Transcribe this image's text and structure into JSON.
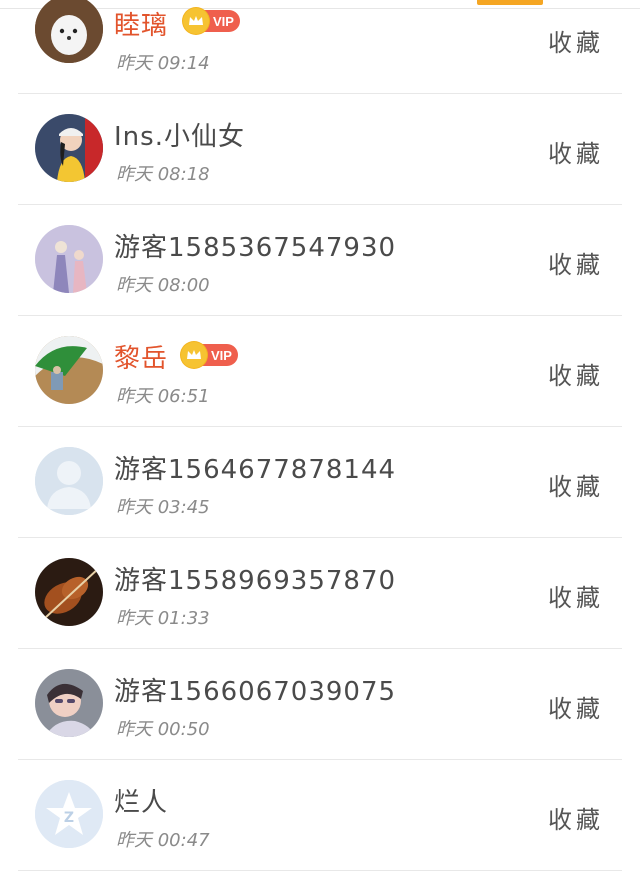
{
  "colors": {
    "accent": "#f5a623",
    "vip_name": "#e2542c",
    "vip_badge": "#ef5f4d"
  },
  "rows": [
    {
      "name": "睦璃",
      "vip": true,
      "vip_label": "VIP",
      "time": "昨天 09:14",
      "action": "收藏",
      "avatar": "white-dog-avatar"
    },
    {
      "name": "Ins.小仙女",
      "vip": false,
      "time": "昨天 08:18",
      "action": "收藏",
      "avatar": "girl-cap-avatar"
    },
    {
      "name": "游客1585367547930",
      "vip": false,
      "time": "昨天 08:00",
      "action": "收藏",
      "avatar": "costume-couple-avatar"
    },
    {
      "name": "黎岳",
      "vip": true,
      "vip_label": "VIP",
      "time": "昨天 06:51",
      "action": "收藏",
      "avatar": "umbrella-scene-avatar"
    },
    {
      "name": "游客1564677878144",
      "vip": false,
      "time": "昨天 03:45",
      "action": "收藏",
      "avatar": "default-person-avatar"
    },
    {
      "name": "游客1558969357870",
      "vip": false,
      "time": "昨天 01:33",
      "action": "收藏",
      "avatar": "violin-avatar"
    },
    {
      "name": "游客1566067039075",
      "vip": false,
      "time": "昨天 00:50",
      "action": "收藏",
      "avatar": "selfie-woman-avatar"
    },
    {
      "name": "烂人",
      "vip": false,
      "time": "昨天 00:47",
      "action": "收藏",
      "avatar": "star-logo-avatar"
    }
  ]
}
